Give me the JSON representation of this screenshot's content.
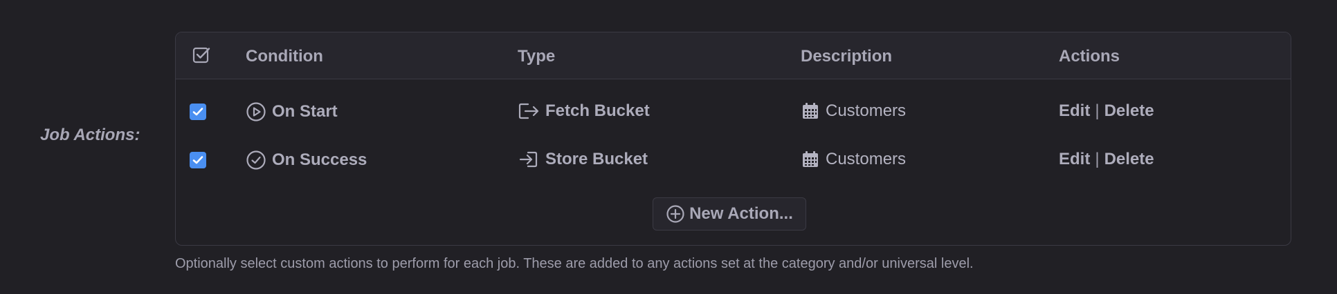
{
  "field": {
    "label": "Job Actions:"
  },
  "table": {
    "columns": {
      "condition": "Condition",
      "type": "Type",
      "description": "Description",
      "actions": "Actions"
    },
    "rows": [
      {
        "checked": true,
        "condition": "On Start",
        "condition_icon": "play-circle-icon",
        "type": "Fetch Bucket",
        "type_icon": "export-arrow-icon",
        "description": "Customers",
        "description_icon": "calendar-icon",
        "edit": "Edit",
        "separator": "|",
        "delete": "Delete"
      },
      {
        "checked": true,
        "condition": "On Success",
        "condition_icon": "check-circle-icon",
        "type": "Store Bucket",
        "type_icon": "import-arrow-icon",
        "description": "Customers",
        "description_icon": "calendar-icon",
        "edit": "Edit",
        "separator": "|",
        "delete": "Delete"
      }
    ],
    "new_action_label": "New Action..."
  },
  "help_text": "Optionally select custom actions to perform for each job. These are added to any actions set at the category and/or universal level.",
  "colors": {
    "background": "#212025",
    "header_background": "#27262d",
    "border": "#3b3a44",
    "text": "#adacbb",
    "checkbox_accent": "#4a8ff1"
  }
}
